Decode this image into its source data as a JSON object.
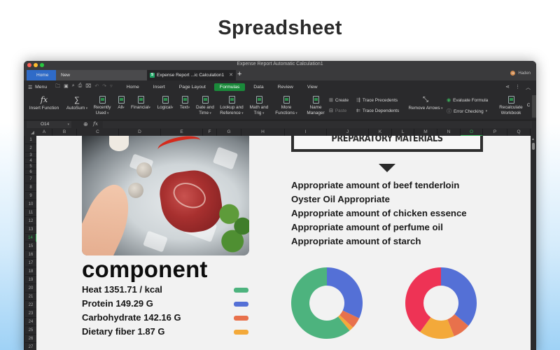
{
  "hero": {
    "title": "Spreadsheet"
  },
  "window": {
    "title": "Expense Report Automatic Calculation1",
    "tabs": [
      {
        "label": "Home",
        "active": false,
        "style": "home"
      },
      {
        "label": "New",
        "active": false
      },
      {
        "label": "Expense Report ...ic Calculation1",
        "active": true,
        "icon": "spreadsheet-s-icon"
      }
    ],
    "add_tab_label": "+",
    "user": {
      "initial": "H",
      "name": "Haden"
    }
  },
  "menubar": {
    "menu_label": "Menu",
    "quick_access_icons": [
      "open-folder-icon",
      "save-icon",
      "format-painter-icon",
      "print-icon",
      "print-preview-icon",
      "undo-icon",
      "redo-icon",
      "more-icon"
    ],
    "tabs": [
      "Home",
      "Insert",
      "Page Layout",
      "Formulas",
      "Data",
      "Review",
      "View"
    ],
    "active_tab": "Formulas",
    "right_icons": [
      "share-icon",
      "more-vertical-icon",
      "collapse-icon"
    ]
  },
  "ribbon": {
    "insert_function": "Insert Function",
    "autosum": "AutoSum",
    "recently_used_1": "Recently",
    "recently_used_2": "Used",
    "all": "All",
    "financial": "Financial",
    "logical": "Logical",
    "text": "Text",
    "date_time_1": "Date and",
    "date_time_2": "Time",
    "lookup_1": "Lookup and",
    "lookup_2": "Reference",
    "math_1": "Math and",
    "math_2": "Trig",
    "more_1": "More",
    "more_2": "Functions",
    "name_manager_1": "Name",
    "name_manager_2": "Manager",
    "create": "Create",
    "paste": "Paste",
    "trace_precedents": "Trace Precedents",
    "trace_dependents": "Trace Dependents",
    "remove_arrows": "Remove Arrows",
    "evaluate_formula": "Evaluate Formula",
    "error_checking": "Error Checking",
    "recalc_1": "Recalculate",
    "recalc_2": "Workbook",
    "cut_off": "C"
  },
  "formula_bar": {
    "cell_ref": "O14",
    "formula": ""
  },
  "grid": {
    "columns": [
      "A",
      "B",
      "C",
      "D",
      "E",
      "F",
      "G",
      "H",
      "I",
      "J",
      "K",
      "L",
      "M",
      "N",
      "O",
      "P",
      "Q"
    ],
    "active_column": "O",
    "rows": [
      "1",
      "2",
      "3",
      "4",
      "5",
      "6",
      "7",
      "8",
      "9",
      "10",
      "11",
      "12",
      "13",
      "14",
      "15",
      "16",
      "17",
      "18",
      "19",
      "20",
      "21",
      "22",
      "23",
      "24",
      "25",
      "26",
      "27"
    ],
    "active_row": "14"
  },
  "sheet": {
    "photo_description": "Raw marbled beef steak on crushed ice with chili, garlic, salt shakers, parsley and a hand",
    "prep_title": "PREPARATORY MATERIALS",
    "ingredients": [
      "Appropriate amount of beef tenderloin",
      "Oyster Oil Appropriate",
      "Appropriate amount of chicken essence",
      "Appropriate amount of perfume oil",
      "Appropriate amount of starch"
    ],
    "component_title": "component",
    "components": [
      {
        "label": "Heat 1351.71 / kcal",
        "color": "#4db37e"
      },
      {
        "label": "Protein 149.29 G",
        "color": "#5470d6"
      },
      {
        "label": "Carbohydrate 142.16 G",
        "color": "#e8714c"
      },
      {
        "label": "Dietary fiber 1.87 G",
        "color": "#f3a93a"
      }
    ]
  },
  "chart_data": [
    {
      "type": "pie",
      "donut": true,
      "title": "",
      "slices": [
        {
          "name": "Protein",
          "value": 32,
          "color": "#5470d6"
        },
        {
          "name": "Carbohydrate",
          "value": 5,
          "color": "#e8714c"
        },
        {
          "name": "Dietary fiber",
          "value": 2,
          "color": "#f3a93a"
        },
        {
          "name": "Heat",
          "value": 61,
          "color": "#4db37e"
        }
      ]
    },
    {
      "type": "pie",
      "donut": true,
      "title": "",
      "slices": [
        {
          "name": "Blue",
          "value": 36,
          "color": "#5470d6"
        },
        {
          "name": "Orange",
          "value": 8,
          "color": "#e8714c"
        },
        {
          "name": "Yellow",
          "value": 16,
          "color": "#f3a93a"
        },
        {
          "name": "Red",
          "value": 40,
          "color": "#ee3355"
        }
      ]
    }
  ]
}
